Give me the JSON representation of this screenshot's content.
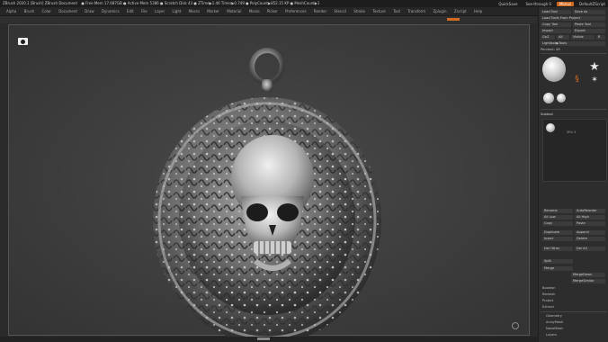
{
  "app": {
    "title": "ZBrush 2020.1 [Brush]   ZBrush Document",
    "stats": "● Free Mem 17.687GB ● Active Mem 5386 ● Scratch Disk 43 ● ZTime▶1.46 Timer▶0.749 ● PolyCount▶852.15 KP ● MeshCount▶1"
  },
  "window_controls": {
    "quicksave": "QuickSave",
    "see_through": "See-through 0",
    "menus": "Menus",
    "script": "DefaultZScript"
  },
  "menubar": [
    "Alpha",
    "Brush",
    "Color",
    "Document",
    "Draw",
    "Dynamics",
    "Edit",
    "File",
    "Layer",
    "Light",
    "Macro",
    "Marker",
    "Material",
    "Movie",
    "Picker",
    "Preferences",
    "Render",
    "Stencil",
    "Stroke",
    "Texture",
    "Tool",
    "Transform",
    "Zplugin",
    "Zscript",
    "Help"
  ],
  "sidepanel": {
    "load_tool": "Load Tool",
    "save_as": "Save As",
    "load_project": "Load Tools From Project",
    "copy_tool": "Copy Tool",
    "paste_tool": "Paste Tool",
    "import": "Import",
    "export": "Export",
    "goz": "GoZ",
    "all": "All",
    "visible": "Visible",
    "r": "R",
    "lightbox_tools": "Lightbox▶Tools",
    "tool_name": "Pendant: 48",
    "subtool_header": "Subtool",
    "spix": "SPix 3",
    "menu_rows": [
      "Rename",
      "AutoReorder",
      "All Low",
      "All High",
      "Copy",
      "Paste",
      "Duplicate",
      "Append",
      "Insert",
      "Delete",
      "Del Other",
      "Del All",
      "Split",
      "Merge",
      "MergeDown",
      "MergeSimilar",
      "Boolean",
      "Remesh",
      "Project",
      "Extract"
    ],
    "bottom_groups": [
      "Geometry",
      "ArrayMesh",
      "NanoMesh",
      "Layers"
    ]
  },
  "colors": {
    "accent": "#d26a1f",
    "canvas": "#3d3d3d",
    "panel": "#2d2d2d"
  },
  "icons": {
    "camera": "camera-icon",
    "gizmo": "navigation-gizmo-icon"
  }
}
